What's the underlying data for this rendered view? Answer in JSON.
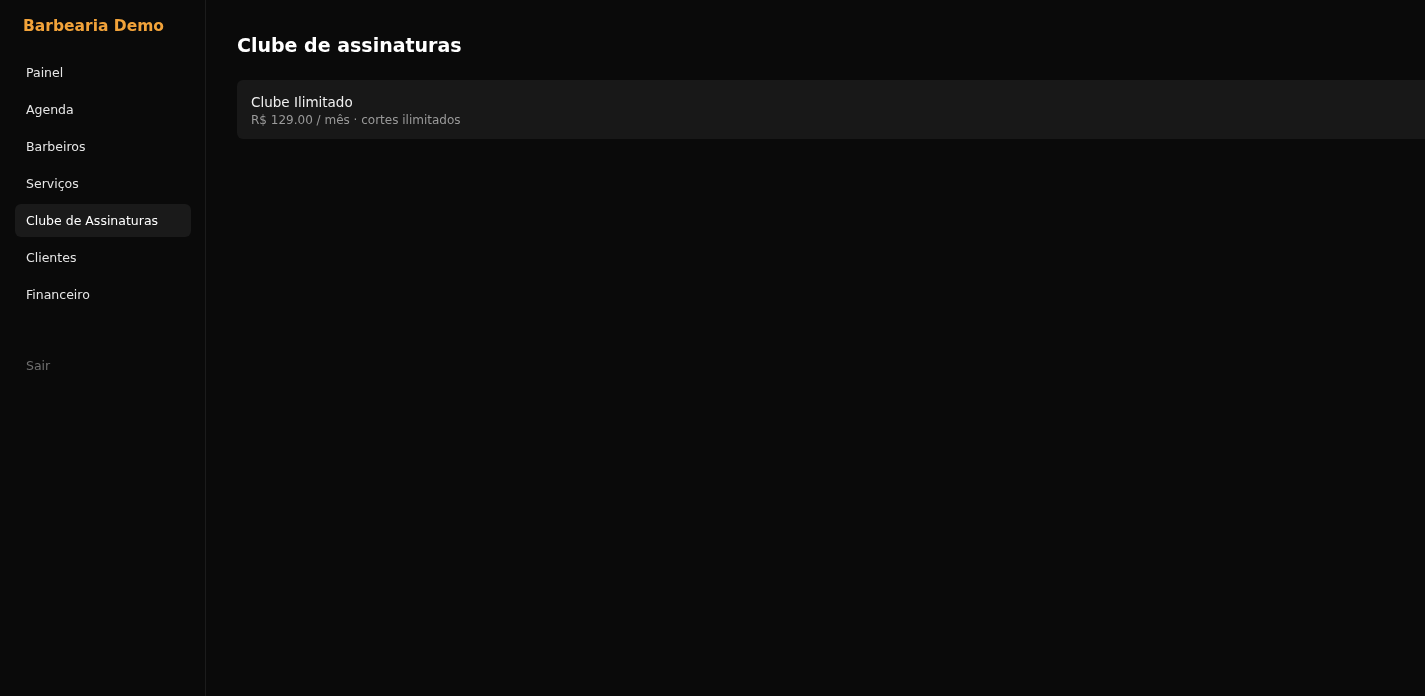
{
  "brand": "Barbearia Demo",
  "nav": [
    {
      "label": "Painel",
      "selected": false
    },
    {
      "label": "Agenda",
      "selected": false
    },
    {
      "label": "Barbeiros",
      "selected": false
    },
    {
      "label": "Serviços",
      "selected": false
    },
    {
      "label": "Clube de Assinaturas",
      "selected": true
    },
    {
      "label": "Clientes",
      "selected": false
    },
    {
      "label": "Financeiro",
      "selected": false
    }
  ],
  "logout": "Sair",
  "page_title": "Clube de assinaturas",
  "plans": [
    {
      "name": "Clube Ilimitado",
      "details": "R$ 129.00 / mês · cortes ilimitados"
    }
  ]
}
